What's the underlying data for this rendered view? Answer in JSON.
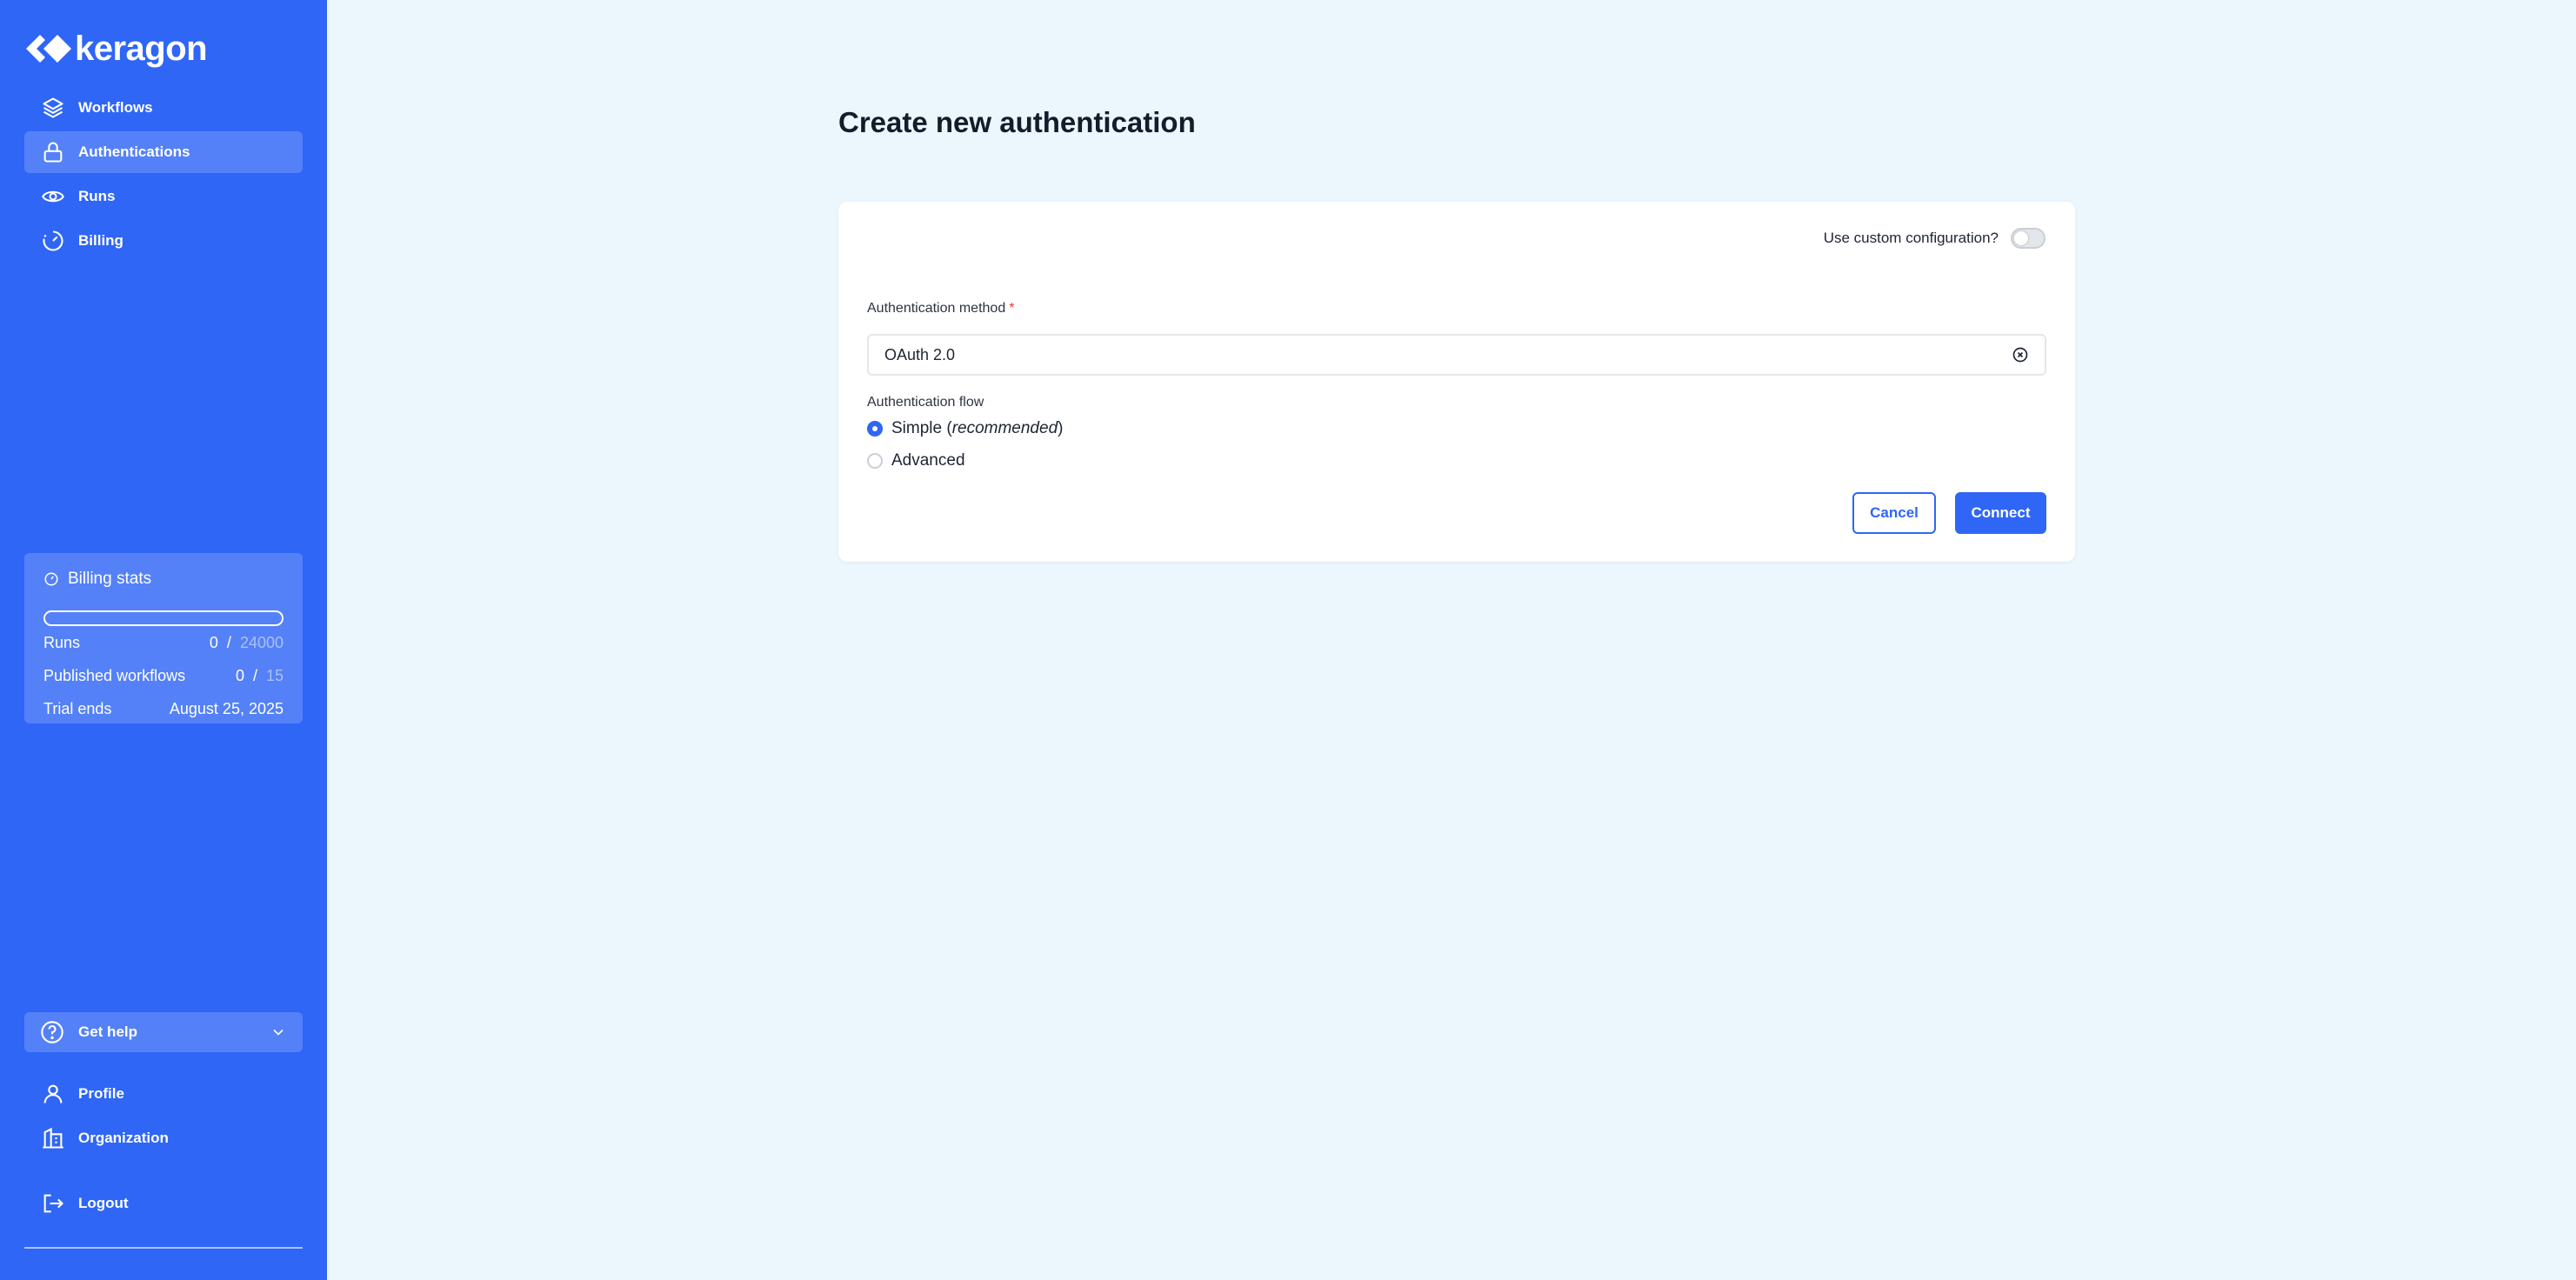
{
  "brand": {
    "name": "keragon"
  },
  "sidebar": {
    "items": [
      {
        "label": "Workflows",
        "icon": "layers-icon"
      },
      {
        "label": "Authentications",
        "icon": "lock-icon",
        "active": true
      },
      {
        "label": "Runs",
        "icon": "eye-icon"
      },
      {
        "label": "Billing",
        "icon": "gauge-icon"
      }
    ],
    "billing_stats": {
      "title": "Billing stats",
      "progress": 0,
      "rows": [
        {
          "label": "Runs",
          "current": "0",
          "separator": "/",
          "max": "24000"
        },
        {
          "label": "Published workflows",
          "current": "0",
          "separator": "/",
          "max": "15"
        }
      ],
      "trial": {
        "label": "Trial ends",
        "value": "August 25, 2025"
      }
    },
    "help": {
      "label": "Get help"
    },
    "bottom": [
      {
        "label": "Profile",
        "icon": "user-icon"
      },
      {
        "label": "Organization",
        "icon": "building-icon"
      }
    ],
    "logout": {
      "label": "Logout"
    }
  },
  "main": {
    "title": "Create new authentication",
    "custom_config_label": "Use custom configuration?",
    "custom_config_enabled": false,
    "auth_method": {
      "label": "Authentication method",
      "required_mark": "*",
      "value": "OAuth 2.0"
    },
    "auth_flow": {
      "label": "Authentication flow",
      "options": [
        {
          "label": "Simple",
          "note": "recommended",
          "checked": true
        },
        {
          "label": "Advanced",
          "checked": false
        }
      ]
    },
    "buttons": {
      "cancel": "Cancel",
      "connect": "Connect"
    }
  },
  "colors": {
    "accent": "#2f66f6",
    "background": "#ebf6fd",
    "required": "#e53935"
  }
}
